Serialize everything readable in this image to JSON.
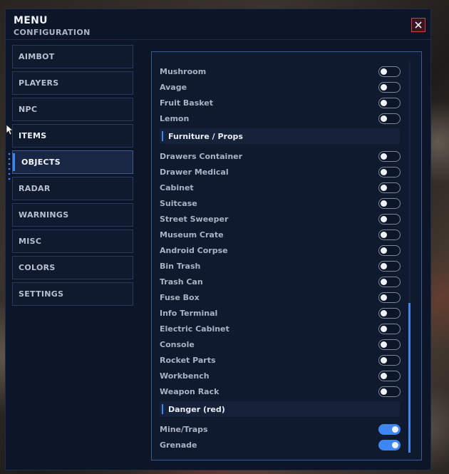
{
  "window": {
    "title": "MENU",
    "subtitle": "CONFIGURATION"
  },
  "nav": {
    "items": [
      {
        "label": "AIMBOT"
      },
      {
        "label": "PLAYERS"
      },
      {
        "label": "NPC"
      },
      {
        "label": "ITEMS"
      },
      {
        "label": "OBJECTS",
        "active": true
      },
      {
        "label": "RADAR"
      },
      {
        "label": "WARNINGS"
      },
      {
        "label": "MISC"
      },
      {
        "label": "COLORS"
      },
      {
        "label": "SETTINGS"
      }
    ]
  },
  "content": {
    "top_rows": [
      {
        "label": "Mushroom",
        "on": false
      },
      {
        "label": "Avage",
        "on": false
      },
      {
        "label": "Fruit Basket",
        "on": false
      },
      {
        "label": "Lemon",
        "on": false
      }
    ],
    "section_furniture": "Furniture / Props",
    "furniture_rows": [
      {
        "label": "Drawers Container",
        "on": false
      },
      {
        "label": "Drawer Medical",
        "on": false
      },
      {
        "label": "Cabinet",
        "on": false
      },
      {
        "label": "Suitcase",
        "on": false
      },
      {
        "label": "Street Sweeper",
        "on": false
      },
      {
        "label": "Museum Crate",
        "on": false
      },
      {
        "label": "Android Corpse",
        "on": false
      },
      {
        "label": "Bin Trash",
        "on": false
      },
      {
        "label": "Trash Can",
        "on": false
      },
      {
        "label": "Fuse Box",
        "on": false
      },
      {
        "label": "Info Terminal",
        "on": false
      },
      {
        "label": "Electric Cabinet",
        "on": false
      },
      {
        "label": "Console",
        "on": false
      },
      {
        "label": "Rocket Parts",
        "on": false
      },
      {
        "label": "Workbench",
        "on": false
      },
      {
        "label": "Weapon Rack",
        "on": false
      }
    ],
    "section_danger": "Danger (red)",
    "danger_rows": [
      {
        "label": "Mine/Traps",
        "on": true
      },
      {
        "label": "Grenade",
        "on": true
      }
    ]
  },
  "colors": {
    "accent": "#3f86f5",
    "background": "#0d1628",
    "close": "#d04040"
  },
  "icons": {
    "close": "close-icon",
    "cursor": "cursor-arrow-icon"
  }
}
